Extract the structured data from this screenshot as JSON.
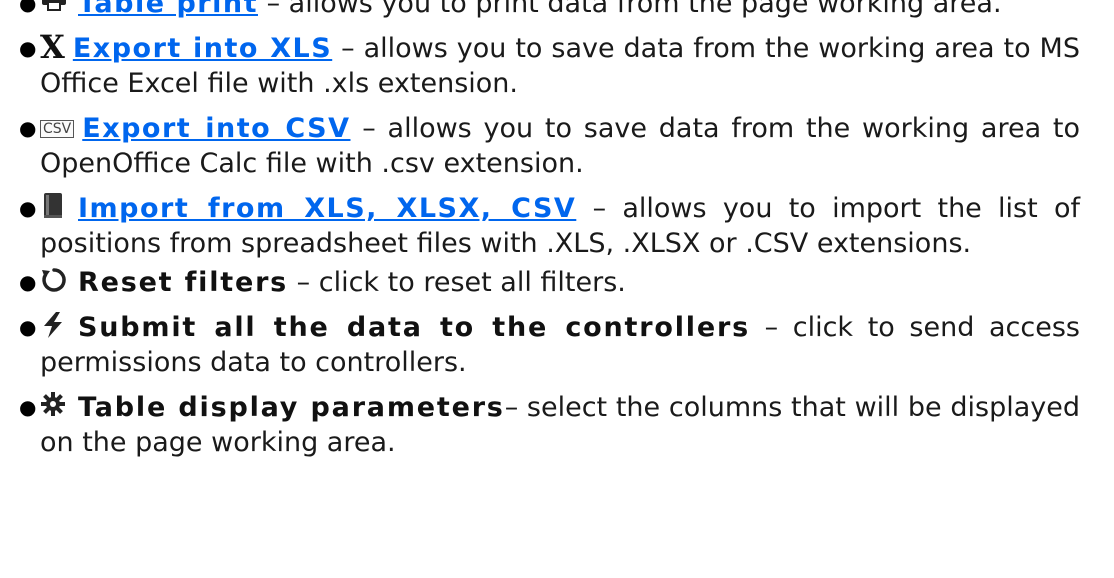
{
  "items": [
    {
      "icon": "printer-icon",
      "title": "Table print",
      "desc": " – allows you to print data from the page working area."
    },
    {
      "icon": "excel-x-icon",
      "icon_text": "X",
      "title": "Export into XLS",
      "desc": " – allows you to save data from the working area to MS Office Excel file with .xls extension."
    },
    {
      "icon": "csv-icon",
      "icon_text": "CSV",
      "title": "Export into CSV",
      "desc": " – allows you to save data from the working area to  OpenOffice Calc file with .csv extension."
    },
    {
      "icon": "book-icon",
      "title": "Import from XLS, XLSX, CSV",
      "desc": " – allows you to import the list of positions from spreadsheet files with .XLS, .XLSX or .CSV extensions."
    },
    {
      "icon": "reset-icon",
      "title": "Reset filters",
      "desc": " – click to reset all filters."
    },
    {
      "icon": "lightning-icon",
      "title": "Submit all the data to the controllers",
      "desc": " – click to send access permissions data to controllers."
    },
    {
      "icon": "gear-icon",
      "title": "Table display parameters",
      "desc": "– select the columns that will be displayed on the page working area."
    }
  ],
  "colors": {
    "link": "#0066ee",
    "text": "#1a1a1a"
  }
}
